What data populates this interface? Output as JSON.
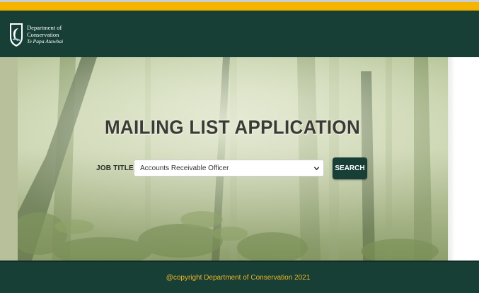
{
  "header": {
    "logo": {
      "line1": "Department of",
      "line2": "Conservation",
      "line3": "Te Papa Atawbai",
      "icon": "doc-logo-icon"
    }
  },
  "main": {
    "title": "MAILING LIST APPLICATION",
    "job_title_label": "JOB TITLE :",
    "job_title_select": {
      "selected": "Accounts Receivable Officer",
      "icon": "chevron-down-icon"
    },
    "search_button": "SEARCH"
  },
  "footer": {
    "text": "@copyright Department of Conservation 2021"
  },
  "colors": {
    "brand_green": "#173f35",
    "accent_yellow": "#f4b400",
    "footer_text": "#f0b429"
  }
}
